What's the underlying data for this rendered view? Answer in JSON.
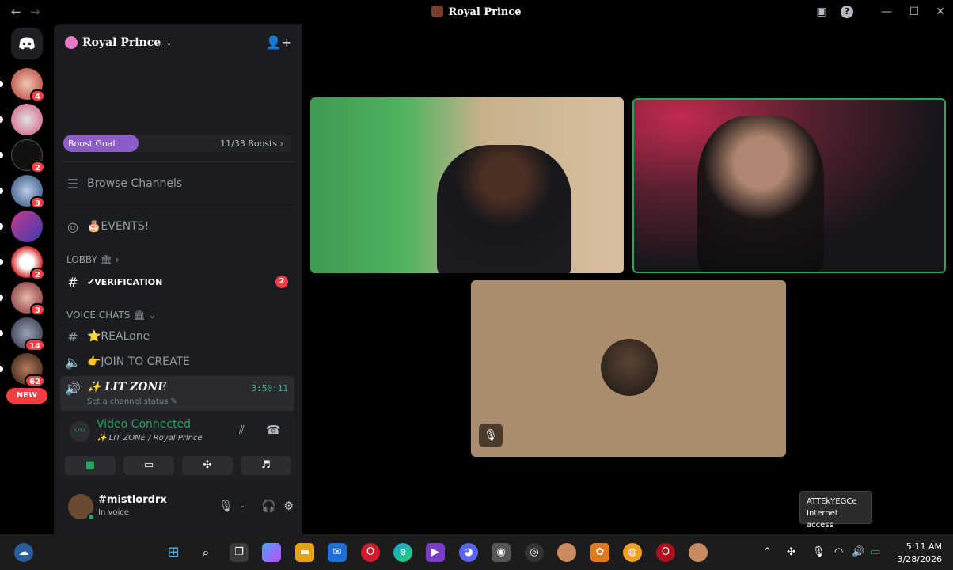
{
  "titlebar": {
    "title": "Royal Prince",
    "back": "←",
    "forward": "→",
    "inbox": "▣",
    "help": "?",
    "min": "—",
    "max": "☐",
    "close": "✕"
  },
  "rail": {
    "badges": [
      "4",
      "2",
      "3",
      "2",
      "3",
      "14",
      "62"
    ],
    "new_label": "NEW"
  },
  "guild": {
    "name": "Royal Prince",
    "chevron": "⌄",
    "add_member": "👤+"
  },
  "boost": {
    "label": "Boost Goal",
    "count": "11/33 Boosts ›",
    "progress": 0.33,
    "color": "#8c5cc9"
  },
  "channels": {
    "browse": "Browse Channels",
    "events": "🎂EVENTS!",
    "lobby_category": "LOBBY 🏛 ›",
    "verification": "✔VERIFICATION",
    "verification_mentions": "2",
    "voice_category": "VOICE CHATS 🏛 ⌄",
    "realone": "⭐REALone",
    "join_to_create": "👉JOIN TO CREATE",
    "lit_zone": "✨ LIT ZONE",
    "lit_zone_timer": "3:50:11",
    "lit_zone_status": "Set a channel status ✎"
  },
  "voice_panel": {
    "title": "Video Connected",
    "subtitle": "✨ LIT ZONE / Royal Prince",
    "buttons": [
      "camera",
      "screen",
      "activities",
      "soundboard"
    ]
  },
  "user": {
    "name": "#mistlordrx",
    "status": "In voice"
  },
  "tooltip": {
    "line1": "ATTEkYEGCe",
    "line2": "Internet access"
  },
  "clock": {
    "time": "5:11 AM",
    "date": "3/28/2026"
  },
  "colors": {
    "connected": "#23a55a",
    "badge": "#f23f43",
    "speaking_border": "#23a55a"
  }
}
